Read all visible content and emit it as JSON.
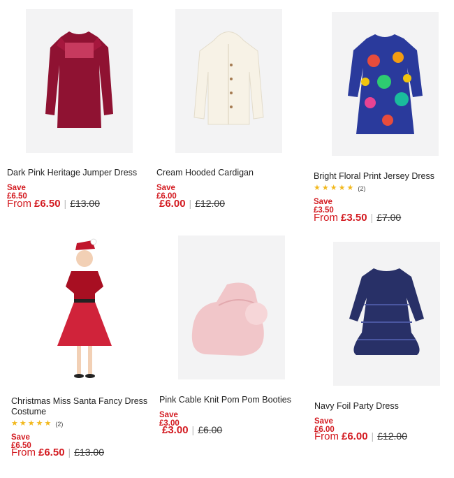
{
  "products": [
    {
      "name": "Dark Pink Heritage Jumper Dress",
      "save": "Save £6.50",
      "from": "From",
      "price": "£6.50",
      "was": "£13.00"
    },
    {
      "name": "Cream Hooded Cardigan",
      "save": "Save £6.00",
      "from": "",
      "price": "£6.00",
      "was": "£12.00"
    },
    {
      "name": "Bright Floral Print Jersey Dress",
      "rating": 5,
      "reviews": "(2)",
      "save": "Save £3.50",
      "from": "From",
      "price": "£3.50",
      "was": "£7.00"
    },
    {
      "name": "Christmas Miss Santa Fancy Dress Costume",
      "rating": 5,
      "reviews": "(2)",
      "save": "Save £6.50",
      "from": "From",
      "price": "£6.50",
      "was": "£13.00"
    },
    {
      "name": "Pink Cable Knit Pom Pom Booties",
      "save": "Save £3.00",
      "from": "",
      "price": "£3.00",
      "was": "£6.00"
    },
    {
      "name": "Navy Foil Party Dress",
      "save": "Save £6.00",
      "from": "From",
      "price": "£6.00",
      "was": "£12.00"
    }
  ],
  "colors": {
    "sale_red": "#d31a20",
    "star_gold": "#f2b81c",
    "image_bg": "#f3f3f4"
  }
}
